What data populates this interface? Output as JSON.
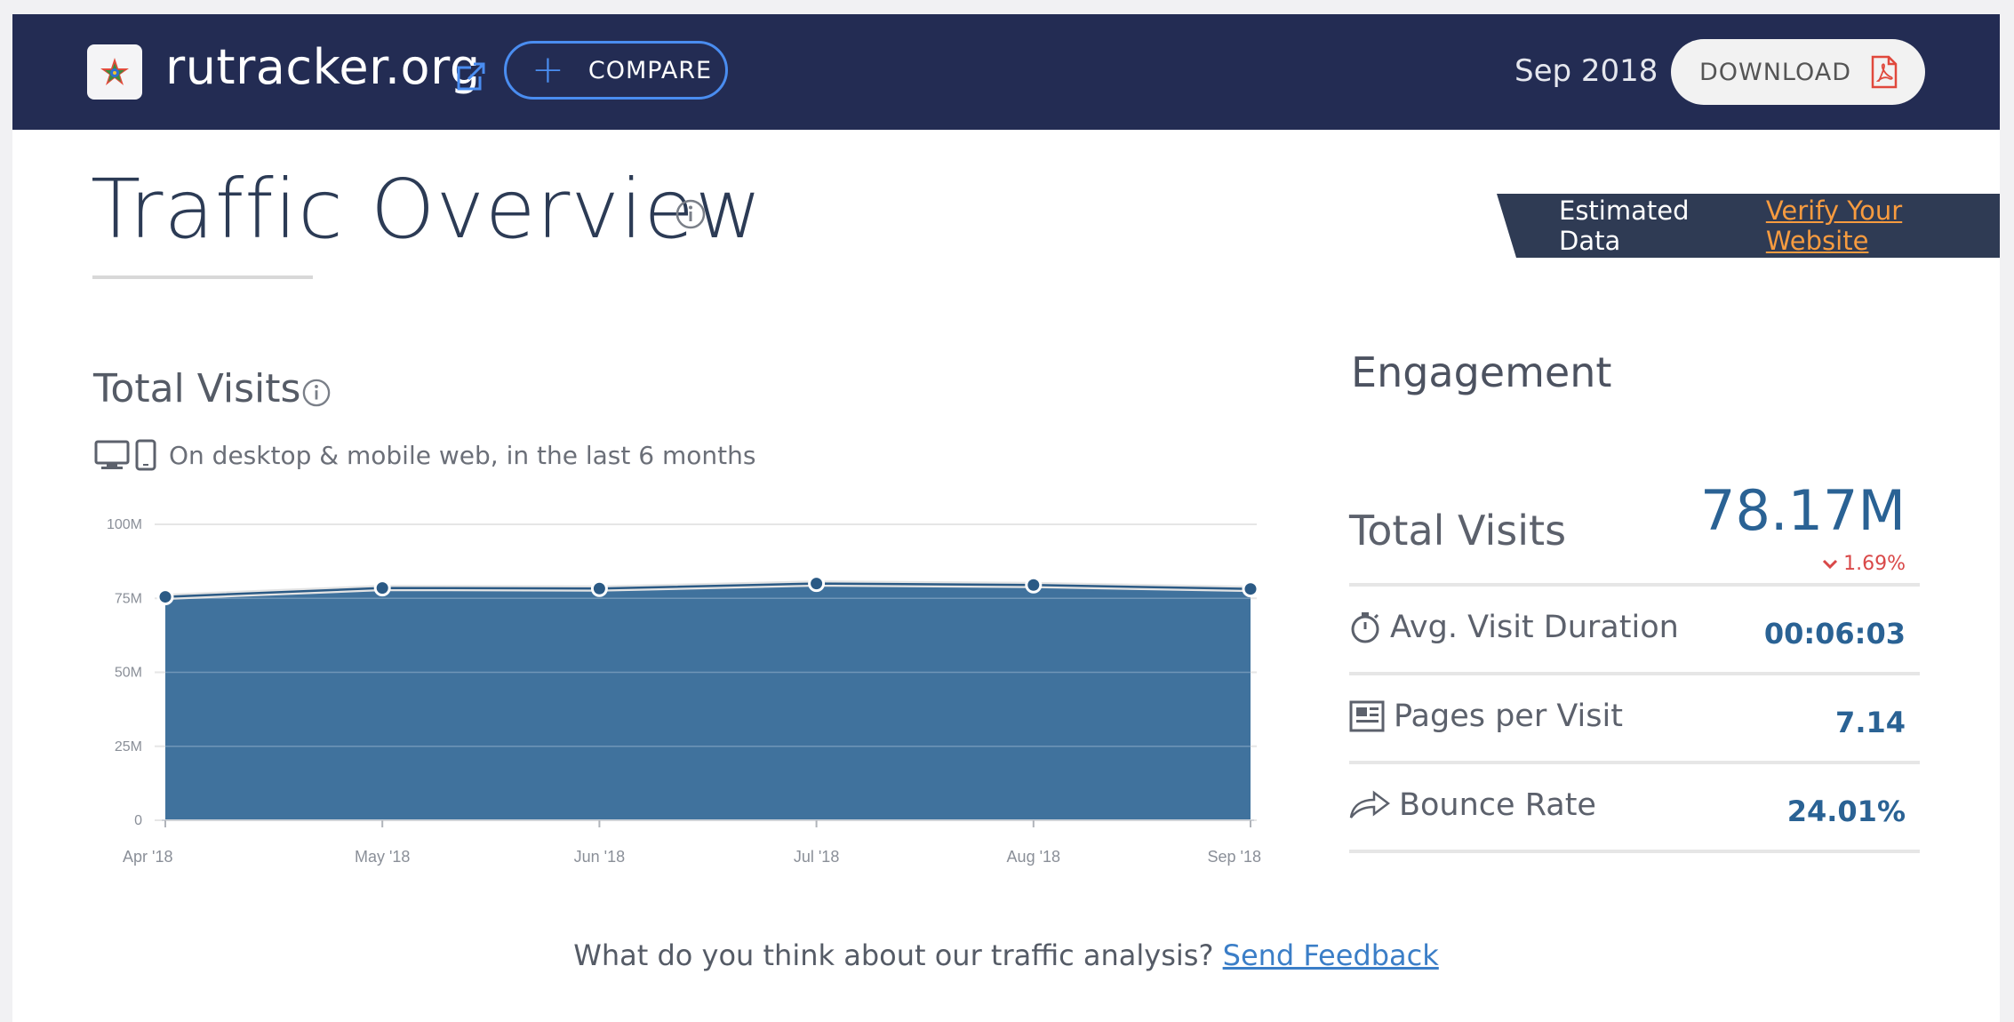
{
  "header": {
    "site_name": "rutracker.org",
    "compare_label": "COMPARE",
    "period": "Sep 2018",
    "download_label": "DOWNLOAD"
  },
  "overview": {
    "title": "Traffic Overview",
    "estimated_label": "Estimated Data",
    "verify_link": "Verify Your Website"
  },
  "total_visits": {
    "title": "Total Visits",
    "subtitle": "On desktop & mobile web, in the last 6 months"
  },
  "chart_data": {
    "type": "area",
    "x": [
      "Apr '18",
      "May '18",
      "Jun '18",
      "Jul '18",
      "Aug '18",
      "Sep '18"
    ],
    "values": [
      75.5,
      78.5,
      78.3,
      80.0,
      79.5,
      78.17
    ],
    "y_ticks": [
      "0",
      "25M",
      "50M",
      "75M",
      "100M"
    ],
    "ylim": [
      0,
      100
    ],
    "grid": true,
    "colors": {
      "area": "#40729d",
      "line": "#2b5a85",
      "grid": "#e6e6e6"
    }
  },
  "engagement": {
    "title": "Engagement",
    "total_visits_label": "Total Visits",
    "total_visits_value": "78.17M",
    "total_visits_change": "1.69%",
    "avg_duration_label": "Avg. Visit Duration",
    "avg_duration_value": "00:06:03",
    "pages_label": "Pages per Visit",
    "pages_value": "7.14",
    "bounce_label": "Bounce Rate",
    "bounce_value": "24.01%"
  },
  "feedback": {
    "question": "What do you think about our traffic analysis?",
    "link": "Send Feedback"
  }
}
